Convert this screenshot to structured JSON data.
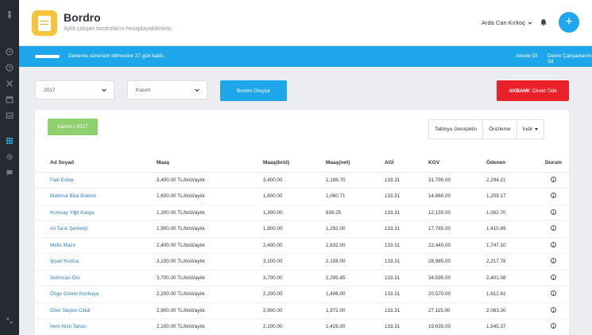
{
  "sidebar": {
    "icons": [
      "user-icon",
      "clock-icon",
      "tools-icon",
      "calendar-icon",
      "inbox-icon",
      "grid-icon",
      "gear-icon",
      "chat-icon",
      "expand-icon"
    ]
  },
  "header": {
    "title": "Bordro",
    "subtitle": "Aylık çalışan bordrolarını hesaplayabilirsiniz.",
    "user_name": "Arda Can Kırkoç",
    "add_label": "+"
  },
  "notice": {
    "text": "Deneme sürenizin bitmesine 27 gün kaldı.",
    "link_subscribe": "Abone Ol",
    "link_demo": "Demo Çalışanlarını Sil"
  },
  "controls": {
    "year_value": "2017",
    "month_value": "Kasım",
    "create_button": "Bordro Oluştur",
    "akbank_logo": "AKBANK",
    "akbank_label": "Direkt Öde"
  },
  "table_card": {
    "period": "Kasım / 2017",
    "btn_expand": "Tabloyu Genişletin",
    "btn_preview": "Önizleme",
    "btn_download": "İndir"
  },
  "table": {
    "headers": [
      "Ad Soyad",
      "Maaş",
      "Maaş(brüt)",
      "Maaş(net)",
      "AGİ",
      "KGV",
      "Ödenen",
      "Durum"
    ],
    "rows": [
      {
        "name": "Faik Ecber",
        "salary": "3,400.00 TL/brüt/aylık",
        "gross": "3,400.00",
        "net": "2,186.70",
        "agi": "133.31",
        "kgv": "31,790.00",
        "paid": "2,294.21"
      },
      {
        "name": "Mahmut Bilal Bülend",
        "salary": "1,600.00 TL/brüt/aylık",
        "gross": "1,600.00",
        "net": "1,060.71",
        "agi": "133.31",
        "kgv": "14,960.00",
        "paid": "1,209.17"
      },
      {
        "name": "Kumsay Yiğit Karga",
        "salary": "1,300.00 TL/brüt/aylık",
        "gross": "1,300.00",
        "net": "939.25",
        "agi": "133.31",
        "kgv": "12,155.00",
        "paid": "1,062.70"
      },
      {
        "name": "Ali Tarık Şerbetçi",
        "salary": "1,900.00 TL/brüt/aylık",
        "gross": "1,900.00",
        "net": "1,292.00",
        "agi": "133.31",
        "kgv": "17,765.00",
        "paid": "1,410.89"
      },
      {
        "name": "Melis Mazır",
        "salary": "2,400.00 TL/brüt/aylık",
        "gross": "2,400.00",
        "net": "1,632.00",
        "agi": "133.31",
        "kgv": "22,440.00",
        "paid": "1,747.10"
      },
      {
        "name": "İpşan Kozica",
        "salary": "3,100.00 TL/brüt/aylık",
        "gross": "3,100.00",
        "net": "2,108.00",
        "agi": "133.31",
        "kgv": "28,985.00",
        "paid": "2,217.78"
      },
      {
        "name": "Selimcan Örs",
        "salary": "3,700.00 TL/brüt/aylık",
        "gross": "3,700.00",
        "net": "2,295.85",
        "agi": "133.31",
        "kgv": "34,595.00",
        "paid": "2,401.08"
      },
      {
        "name": "Özge Gizem Kozbaya",
        "salary": "2,200.00 TL/brüt/aylık",
        "gross": "2,200.00",
        "net": "1,496.00",
        "agi": "133.31",
        "kgv": "20,570.00",
        "paid": "1,612.61"
      },
      {
        "name": "Özer Seçkin Ciddi",
        "salary": "2,900.00 TL/brüt/aylık",
        "gross": "2,900.00",
        "net": "1,972.00",
        "agi": "133.31",
        "kgv": "27,115.00",
        "paid": "2,083.30"
      },
      {
        "name": "İrem Nish Tahun",
        "salary": "2,100.00 TL/brüt/aylık",
        "gross": "2,100.00",
        "net": "1,428.00",
        "agi": "133.31",
        "kgv": "19,635.00",
        "paid": "1,545.37"
      }
    ]
  }
}
